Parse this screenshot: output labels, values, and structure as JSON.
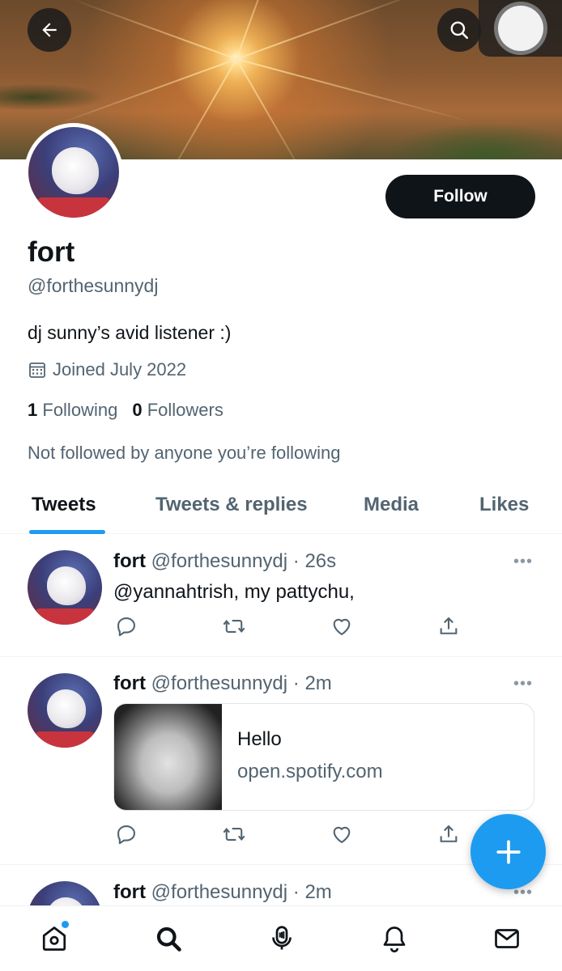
{
  "profile": {
    "name": "fort",
    "handle": "@forthesunnydj",
    "bio": "dj sunny’s avid listener :)",
    "joined": "Joined July 2022",
    "following_count": "1",
    "following_label": "Following",
    "followers_count": "0",
    "followers_label": "Followers",
    "not_followed_text": "Not followed by anyone you’re following"
  },
  "header": {
    "back_icon": "arrow-left-icon",
    "search_icon": "search-icon",
    "follow_label": "Follow"
  },
  "tabs": [
    {
      "label": "Tweets",
      "active": true
    },
    {
      "label": "Tweets & replies",
      "active": false
    },
    {
      "label": "Media",
      "active": false
    },
    {
      "label": "Likes",
      "active": false
    }
  ],
  "tweets": [
    {
      "name": "fort",
      "meta": "@forthesunnydj · 26s",
      "text": "@yannahtrish, my pattychu,"
    },
    {
      "name": "fort",
      "meta": "@forthesunnydj · 2m",
      "card": {
        "title": "Hello",
        "domain": "open.spotify.com"
      }
    },
    {
      "name": "fort",
      "meta": "@forthesunnydj · 2m"
    }
  ],
  "more_glyph": "•••",
  "bottom_nav": [
    "home-icon",
    "search-icon",
    "spaces-icon",
    "notifications-icon",
    "messages-icon"
  ],
  "colors": {
    "accent": "#1d9bf0",
    "text": "#0f1419",
    "secondary": "#536471"
  }
}
